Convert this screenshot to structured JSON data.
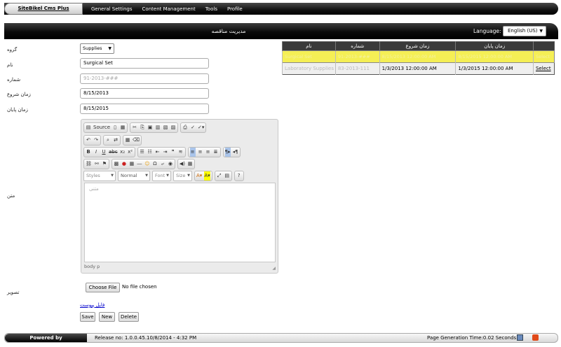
{
  "topbar": {
    "brand": "SiteBikel Cms Plus",
    "menu": [
      "General Settings",
      "Content Management",
      "Tools",
      "Profile"
    ]
  },
  "titlebar": {
    "title": "مديريت مناقصه",
    "language_label": "Language:",
    "language_value": "English (US)"
  },
  "form": {
    "group_label": "گروه",
    "group_value": "Supplies",
    "name_label": "نام",
    "name_value": "Surgical Set",
    "number_label": "شماره",
    "number_value": "91-2013-###",
    "start_label": "زمان شروع",
    "start_value": "8/15/2013",
    "end_label": "زمان پايان",
    "end_value": "8/15/2015",
    "text_label": "متن",
    "image_label": "تصویر",
    "choose_file": "Choose File",
    "no_file": "No file chosen",
    "attachment_link": "فایل پیوست",
    "save": "Save",
    "new": "New",
    "delete": "Delete"
  },
  "editor": {
    "source": "Source",
    "styles": "Styles",
    "format": "Normal",
    "font": "Font",
    "size": "Size",
    "content": "متنی",
    "status_path": "body  p"
  },
  "grid": {
    "headers": [
      "نام",
      "شماره",
      "زمان شروع",
      "زمان پايان",
      ""
    ],
    "rows": [
      {
        "name": "Surgical Set",
        "number": "91-2013-###",
        "start": "8/15/2013 12:00:00 AM",
        "end": "8/15/2015 12:00:00 AM",
        "action": "Select"
      },
      {
        "name": "Laboratory Supplies",
        "number": "83-2013-111",
        "start": "1/3/2013 12:00:00 AM",
        "end": "1/3/2015 12:00:00 AM",
        "action": "Select"
      }
    ]
  },
  "footer": {
    "powered": "Powered by",
    "release": "Release no: 1.0.0.45.10/8/2014 - 4:32 PM",
    "generation": "Page Generation Time:0.02  Seconds"
  },
  "colors": {
    "selected_row": "#f5ef55",
    "bar_dark": "#000000"
  }
}
